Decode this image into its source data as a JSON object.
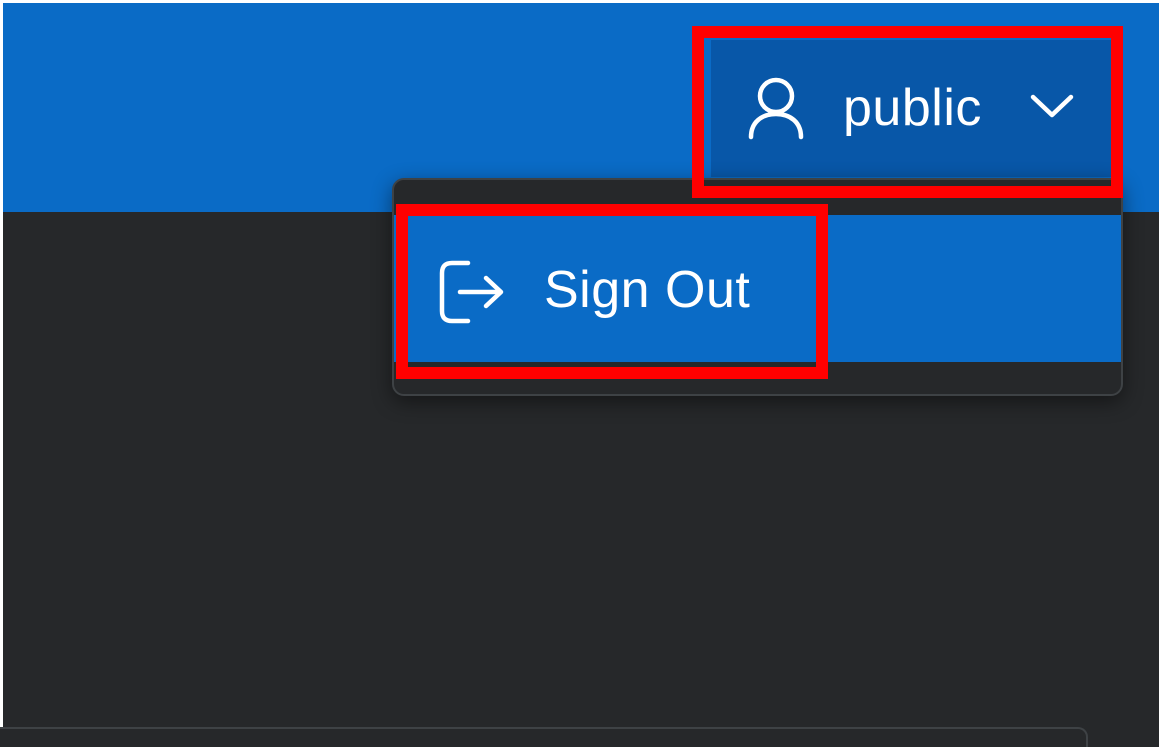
{
  "header": {
    "user_menu": {
      "label": "public",
      "icon": "user-icon",
      "expand_icon": "chevron-down-icon"
    }
  },
  "dropdown": {
    "items": [
      {
        "label": "Sign Out",
        "icon": "sign-out-icon"
      }
    ]
  },
  "colors": {
    "header_bg": "#0a6bc6",
    "user_button_bg": "#0857a8",
    "menu_bg": "#26282a",
    "menu_item_active_bg": "#0a6bc6",
    "highlight": "#ff0000",
    "text": "#ffffff"
  }
}
